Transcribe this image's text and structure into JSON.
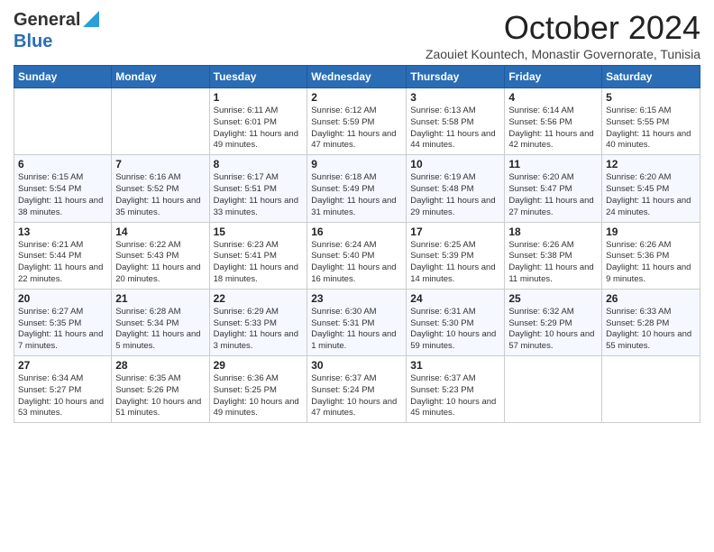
{
  "logo": {
    "general": "General",
    "blue": "Blue"
  },
  "header": {
    "month_year": "October 2024",
    "subtitle": "Zaouiet Kountech, Monastir Governorate, Tunisia"
  },
  "columns": [
    "Sunday",
    "Monday",
    "Tuesday",
    "Wednesday",
    "Thursday",
    "Friday",
    "Saturday"
  ],
  "weeks": [
    [
      {
        "day": "",
        "sunrise": "",
        "sunset": "",
        "daylight": ""
      },
      {
        "day": "",
        "sunrise": "",
        "sunset": "",
        "daylight": ""
      },
      {
        "day": "1",
        "sunrise": "Sunrise: 6:11 AM",
        "sunset": "Sunset: 6:01 PM",
        "daylight": "Daylight: 11 hours and 49 minutes."
      },
      {
        "day": "2",
        "sunrise": "Sunrise: 6:12 AM",
        "sunset": "Sunset: 5:59 PM",
        "daylight": "Daylight: 11 hours and 47 minutes."
      },
      {
        "day": "3",
        "sunrise": "Sunrise: 6:13 AM",
        "sunset": "Sunset: 5:58 PM",
        "daylight": "Daylight: 11 hours and 44 minutes."
      },
      {
        "day": "4",
        "sunrise": "Sunrise: 6:14 AM",
        "sunset": "Sunset: 5:56 PM",
        "daylight": "Daylight: 11 hours and 42 minutes."
      },
      {
        "day": "5",
        "sunrise": "Sunrise: 6:15 AM",
        "sunset": "Sunset: 5:55 PM",
        "daylight": "Daylight: 11 hours and 40 minutes."
      }
    ],
    [
      {
        "day": "6",
        "sunrise": "Sunrise: 6:15 AM",
        "sunset": "Sunset: 5:54 PM",
        "daylight": "Daylight: 11 hours and 38 minutes."
      },
      {
        "day": "7",
        "sunrise": "Sunrise: 6:16 AM",
        "sunset": "Sunset: 5:52 PM",
        "daylight": "Daylight: 11 hours and 35 minutes."
      },
      {
        "day": "8",
        "sunrise": "Sunrise: 6:17 AM",
        "sunset": "Sunset: 5:51 PM",
        "daylight": "Daylight: 11 hours and 33 minutes."
      },
      {
        "day": "9",
        "sunrise": "Sunrise: 6:18 AM",
        "sunset": "Sunset: 5:49 PM",
        "daylight": "Daylight: 11 hours and 31 minutes."
      },
      {
        "day": "10",
        "sunrise": "Sunrise: 6:19 AM",
        "sunset": "Sunset: 5:48 PM",
        "daylight": "Daylight: 11 hours and 29 minutes."
      },
      {
        "day": "11",
        "sunrise": "Sunrise: 6:20 AM",
        "sunset": "Sunset: 5:47 PM",
        "daylight": "Daylight: 11 hours and 27 minutes."
      },
      {
        "day": "12",
        "sunrise": "Sunrise: 6:20 AM",
        "sunset": "Sunset: 5:45 PM",
        "daylight": "Daylight: 11 hours and 24 minutes."
      }
    ],
    [
      {
        "day": "13",
        "sunrise": "Sunrise: 6:21 AM",
        "sunset": "Sunset: 5:44 PM",
        "daylight": "Daylight: 11 hours and 22 minutes."
      },
      {
        "day": "14",
        "sunrise": "Sunrise: 6:22 AM",
        "sunset": "Sunset: 5:43 PM",
        "daylight": "Daylight: 11 hours and 20 minutes."
      },
      {
        "day": "15",
        "sunrise": "Sunrise: 6:23 AM",
        "sunset": "Sunset: 5:41 PM",
        "daylight": "Daylight: 11 hours and 18 minutes."
      },
      {
        "day": "16",
        "sunrise": "Sunrise: 6:24 AM",
        "sunset": "Sunset: 5:40 PM",
        "daylight": "Daylight: 11 hours and 16 minutes."
      },
      {
        "day": "17",
        "sunrise": "Sunrise: 6:25 AM",
        "sunset": "Sunset: 5:39 PM",
        "daylight": "Daylight: 11 hours and 14 minutes."
      },
      {
        "day": "18",
        "sunrise": "Sunrise: 6:26 AM",
        "sunset": "Sunset: 5:38 PM",
        "daylight": "Daylight: 11 hours and 11 minutes."
      },
      {
        "day": "19",
        "sunrise": "Sunrise: 6:26 AM",
        "sunset": "Sunset: 5:36 PM",
        "daylight": "Daylight: 11 hours and 9 minutes."
      }
    ],
    [
      {
        "day": "20",
        "sunrise": "Sunrise: 6:27 AM",
        "sunset": "Sunset: 5:35 PM",
        "daylight": "Daylight: 11 hours and 7 minutes."
      },
      {
        "day": "21",
        "sunrise": "Sunrise: 6:28 AM",
        "sunset": "Sunset: 5:34 PM",
        "daylight": "Daylight: 11 hours and 5 minutes."
      },
      {
        "day": "22",
        "sunrise": "Sunrise: 6:29 AM",
        "sunset": "Sunset: 5:33 PM",
        "daylight": "Daylight: 11 hours and 3 minutes."
      },
      {
        "day": "23",
        "sunrise": "Sunrise: 6:30 AM",
        "sunset": "Sunset: 5:31 PM",
        "daylight": "Daylight: 11 hours and 1 minute."
      },
      {
        "day": "24",
        "sunrise": "Sunrise: 6:31 AM",
        "sunset": "Sunset: 5:30 PM",
        "daylight": "Daylight: 10 hours and 59 minutes."
      },
      {
        "day": "25",
        "sunrise": "Sunrise: 6:32 AM",
        "sunset": "Sunset: 5:29 PM",
        "daylight": "Daylight: 10 hours and 57 minutes."
      },
      {
        "day": "26",
        "sunrise": "Sunrise: 6:33 AM",
        "sunset": "Sunset: 5:28 PM",
        "daylight": "Daylight: 10 hours and 55 minutes."
      }
    ],
    [
      {
        "day": "27",
        "sunrise": "Sunrise: 6:34 AM",
        "sunset": "Sunset: 5:27 PM",
        "daylight": "Daylight: 10 hours and 53 minutes."
      },
      {
        "day": "28",
        "sunrise": "Sunrise: 6:35 AM",
        "sunset": "Sunset: 5:26 PM",
        "daylight": "Daylight: 10 hours and 51 minutes."
      },
      {
        "day": "29",
        "sunrise": "Sunrise: 6:36 AM",
        "sunset": "Sunset: 5:25 PM",
        "daylight": "Daylight: 10 hours and 49 minutes."
      },
      {
        "day": "30",
        "sunrise": "Sunrise: 6:37 AM",
        "sunset": "Sunset: 5:24 PM",
        "daylight": "Daylight: 10 hours and 47 minutes."
      },
      {
        "day": "31",
        "sunrise": "Sunrise: 6:37 AM",
        "sunset": "Sunset: 5:23 PM",
        "daylight": "Daylight: 10 hours and 45 minutes."
      },
      {
        "day": "",
        "sunrise": "",
        "sunset": "",
        "daylight": ""
      },
      {
        "day": "",
        "sunrise": "",
        "sunset": "",
        "daylight": ""
      }
    ]
  ]
}
